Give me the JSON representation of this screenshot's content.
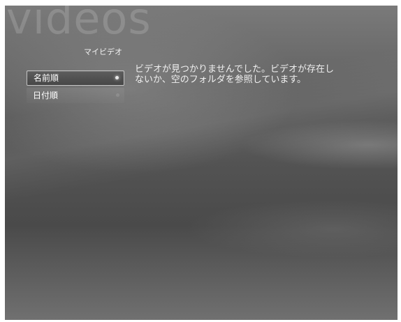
{
  "header": {
    "watermark": "videos",
    "title": "マイビデオ"
  },
  "sort_menu": {
    "items": [
      {
        "label": "名前順",
        "selected": true
      },
      {
        "label": "日付順",
        "selected": false
      }
    ]
  },
  "main": {
    "message_line1": "ビデオが見つかりませんでした。ビデオが存在し",
    "message_line2": "ないか、空のフォルダを参照しています。"
  }
}
